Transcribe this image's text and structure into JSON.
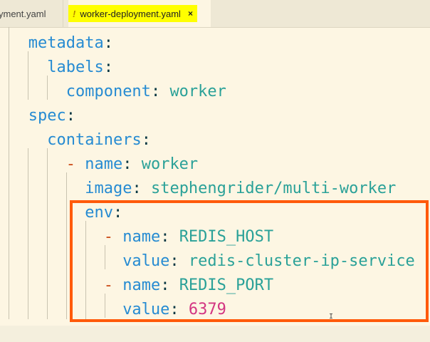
{
  "tabs": [
    {
      "label": "yment.yaml",
      "active": false
    },
    {
      "label": "worker-deployment.yaml",
      "active": true,
      "warning_glyph": "!",
      "close_glyph": "×"
    }
  ],
  "code": [
    {
      "indent": "  ",
      "key": "metadata",
      "sep": ":",
      "value": ""
    },
    {
      "indent": "    ",
      "key": "labels",
      "sep": ":",
      "value": ""
    },
    {
      "indent": "      ",
      "key": "component",
      "sep": ": ",
      "value": "worker"
    },
    {
      "indent": "  ",
      "key": "spec",
      "sep": ":",
      "value": ""
    },
    {
      "indent": "    ",
      "key": "containers",
      "sep": ":",
      "value": ""
    },
    {
      "indent": "      ",
      "dash": "- ",
      "key": "name",
      "sep": ": ",
      "value": "worker"
    },
    {
      "indent": "        ",
      "key": "image",
      "sep": ": ",
      "value": "stephengrider/multi-worker"
    },
    {
      "indent": "        ",
      "key": "env",
      "sep": ":",
      "value": ""
    },
    {
      "indent": "          ",
      "dash": "- ",
      "key": "name",
      "sep": ": ",
      "value": "REDIS_HOST"
    },
    {
      "indent": "            ",
      "key": "value",
      "sep": ": ",
      "value": "redis-cluster-ip-service"
    },
    {
      "indent": "          ",
      "dash": "- ",
      "key": "name",
      "sep": ": ",
      "value": "REDIS_PORT"
    },
    {
      "indent": "            ",
      "key": "value",
      "sep": ": ",
      "value": "6379",
      "numeric": true
    }
  ],
  "colors": {
    "background": "#fdf6e3",
    "key": "#268bd2",
    "string": "#2aa198",
    "number": "#d33682",
    "highlight_border": "#ff5a0a",
    "tab_highlight": "#ffff00"
  },
  "cursor_icon": "i-beam-cursor-icon"
}
